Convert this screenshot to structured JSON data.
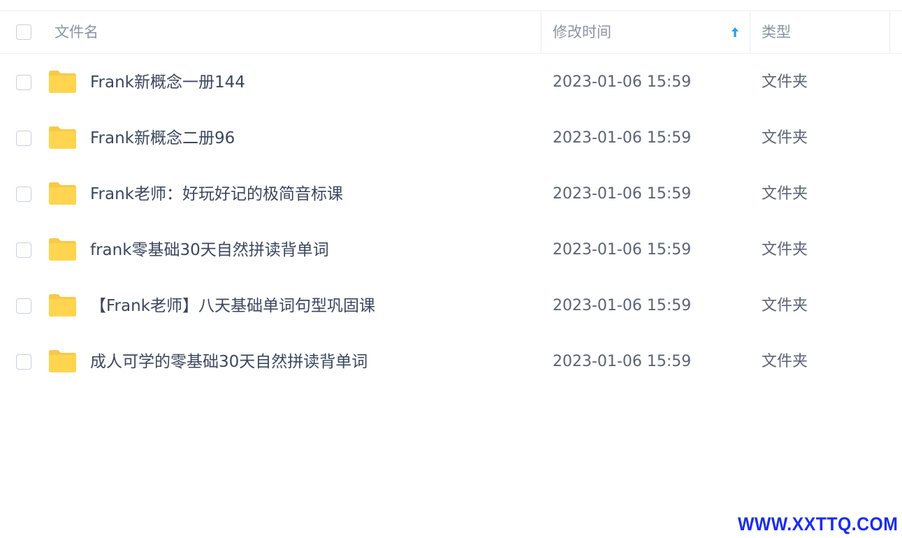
{
  "header": {
    "name_label": "文件名",
    "time_label": "修改时间",
    "type_label": "类型"
  },
  "files": [
    {
      "name": "Frank新概念一册144",
      "modified": "2023-01-06 15:59",
      "type": "文件夹"
    },
    {
      "name": "Frank新概念二册96",
      "modified": "2023-01-06 15:59",
      "type": "文件夹"
    },
    {
      "name": "Frank老师：好玩好记的极简音标课",
      "modified": "2023-01-06 15:59",
      "type": "文件夹"
    },
    {
      "name": "frank零基础30天自然拼读背单词",
      "modified": "2023-01-06 15:59",
      "type": "文件夹"
    },
    {
      "name": "【Frank老师】八天基础单词句型巩固课",
      "modified": "2023-01-06 15:59",
      "type": "文件夹"
    },
    {
      "name": "成人可学的零基础30天自然拼读背单词",
      "modified": "2023-01-06 15:59",
      "type": "文件夹"
    }
  ],
  "watermark": "WWW.XXTTQ.COM",
  "colors": {
    "folder": "#ffd54f",
    "sort_arrow": "#1e9fff",
    "watermark": "#1a2cf0"
  }
}
